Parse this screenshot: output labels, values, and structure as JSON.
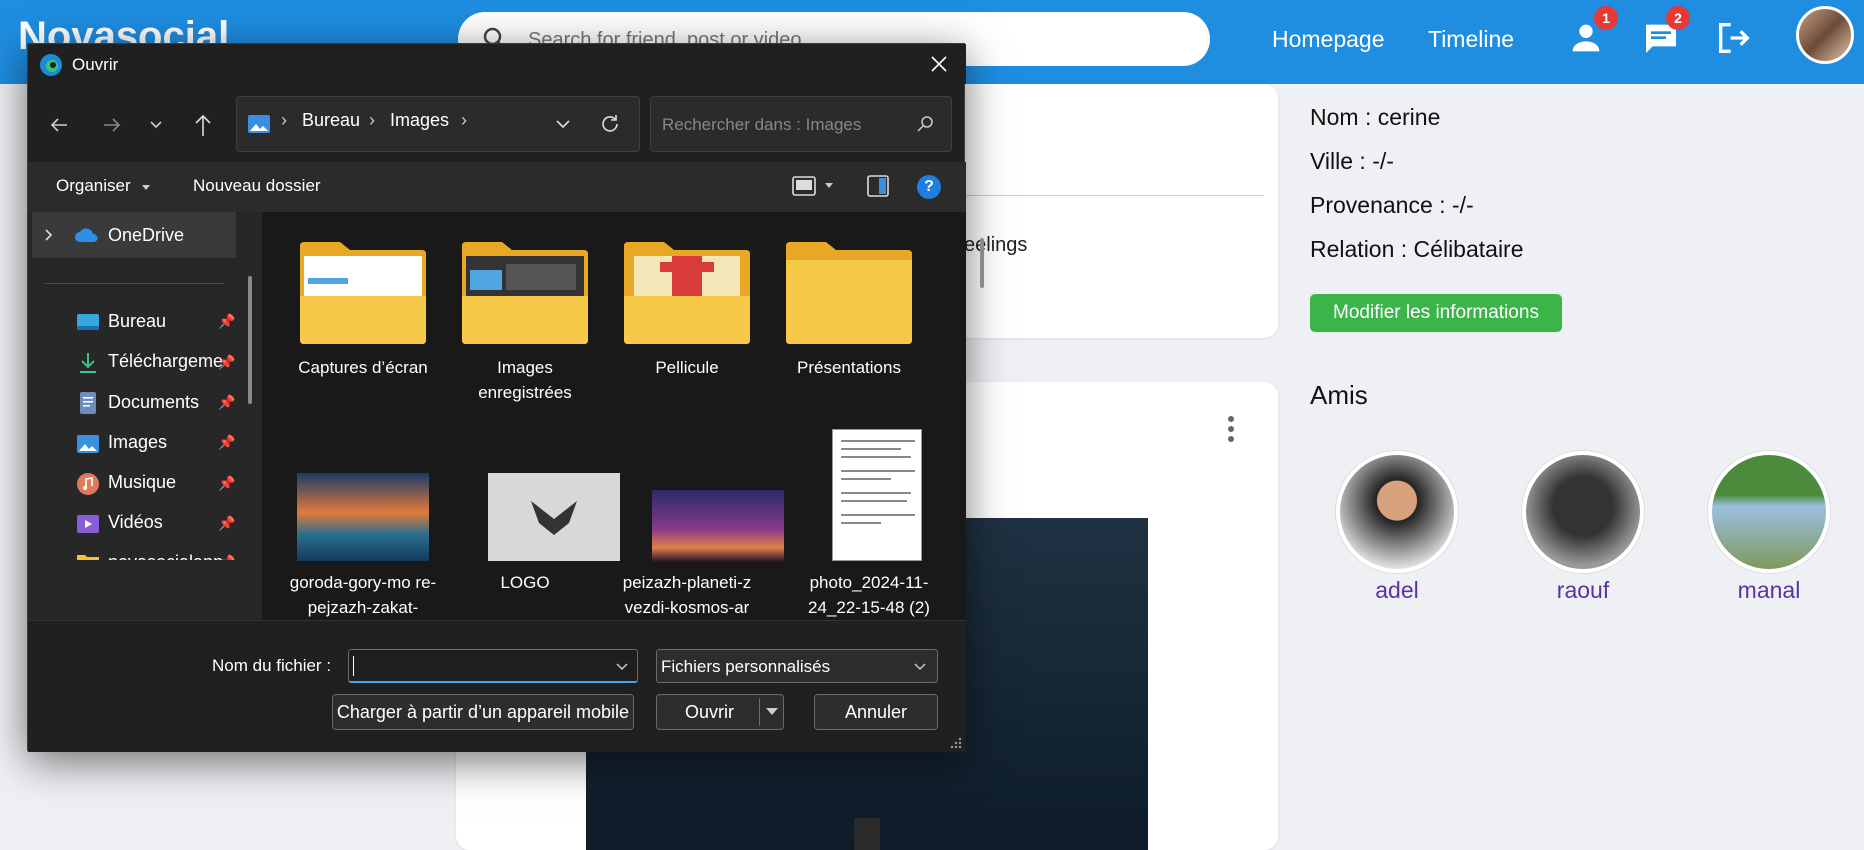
{
  "app": {
    "logo": "Novasocial",
    "search_placeholder": "Search for friend, post or video",
    "nav": {
      "homepage": "Homepage",
      "timeline": "Timeline"
    },
    "badges": {
      "friends": "1",
      "messages": "2"
    }
  },
  "profile": {
    "name_line": "Nom : cerine",
    "city_line": "Ville : -/-",
    "origin_line": "Provenance : -/-",
    "relation_line": "Relation : Célibataire",
    "edit_button": "Modifier les informations",
    "friends_title": "Amis",
    "friends": [
      {
        "name": "adel"
      },
      {
        "name": "raouf"
      },
      {
        "name": "manal"
      }
    ],
    "partial_text": "eelings"
  },
  "dialog": {
    "title": "Ouvrir",
    "breadcrumb": [
      "Bureau",
      "Images"
    ],
    "search_placeholder": "Rechercher dans : Images",
    "organize": "Organiser",
    "new_folder": "Nouveau dossier",
    "help": "?",
    "sidebar": {
      "onedrive": "OneDrive",
      "items": [
        {
          "label": "Bureau",
          "icon": "desktop-icon"
        },
        {
          "label": "Téléchargeme",
          "icon": "download-icon"
        },
        {
          "label": "Documents",
          "icon": "documents-icon"
        },
        {
          "label": "Images",
          "icon": "images-icon"
        },
        {
          "label": "Musique",
          "icon": "music-icon"
        },
        {
          "label": "Vidéos",
          "icon": "videos-icon"
        },
        {
          "label": "novasocialapp",
          "icon": "folder-icon"
        }
      ]
    },
    "folders": [
      {
        "label": "Captures d’écran"
      },
      {
        "label": "Images enregistrées"
      },
      {
        "label": "Pellicule"
      },
      {
        "label": "Présentations"
      }
    ],
    "files": [
      {
        "label": "goroda-gory-mo re-pejzazh-zakat-"
      },
      {
        "label": "LOGO"
      },
      {
        "label": "peizazh-planeti-z vezdi-kosmos-ar"
      },
      {
        "label": "photo_2024-11- 24_22-15-48 (2)"
      }
    ],
    "filename_label": "Nom du fichier :",
    "filename_value": "",
    "filetype": "Fichiers personnalisés",
    "mobile_button": "Charger à partir d’un appareil mobile",
    "open_button": "Ouvrir",
    "cancel_button": "Annuler"
  },
  "colors": {
    "accent": "#1f8de0",
    "green": "#3bb54a",
    "badge": "#e53935",
    "friend_name": "#5a32a3"
  }
}
